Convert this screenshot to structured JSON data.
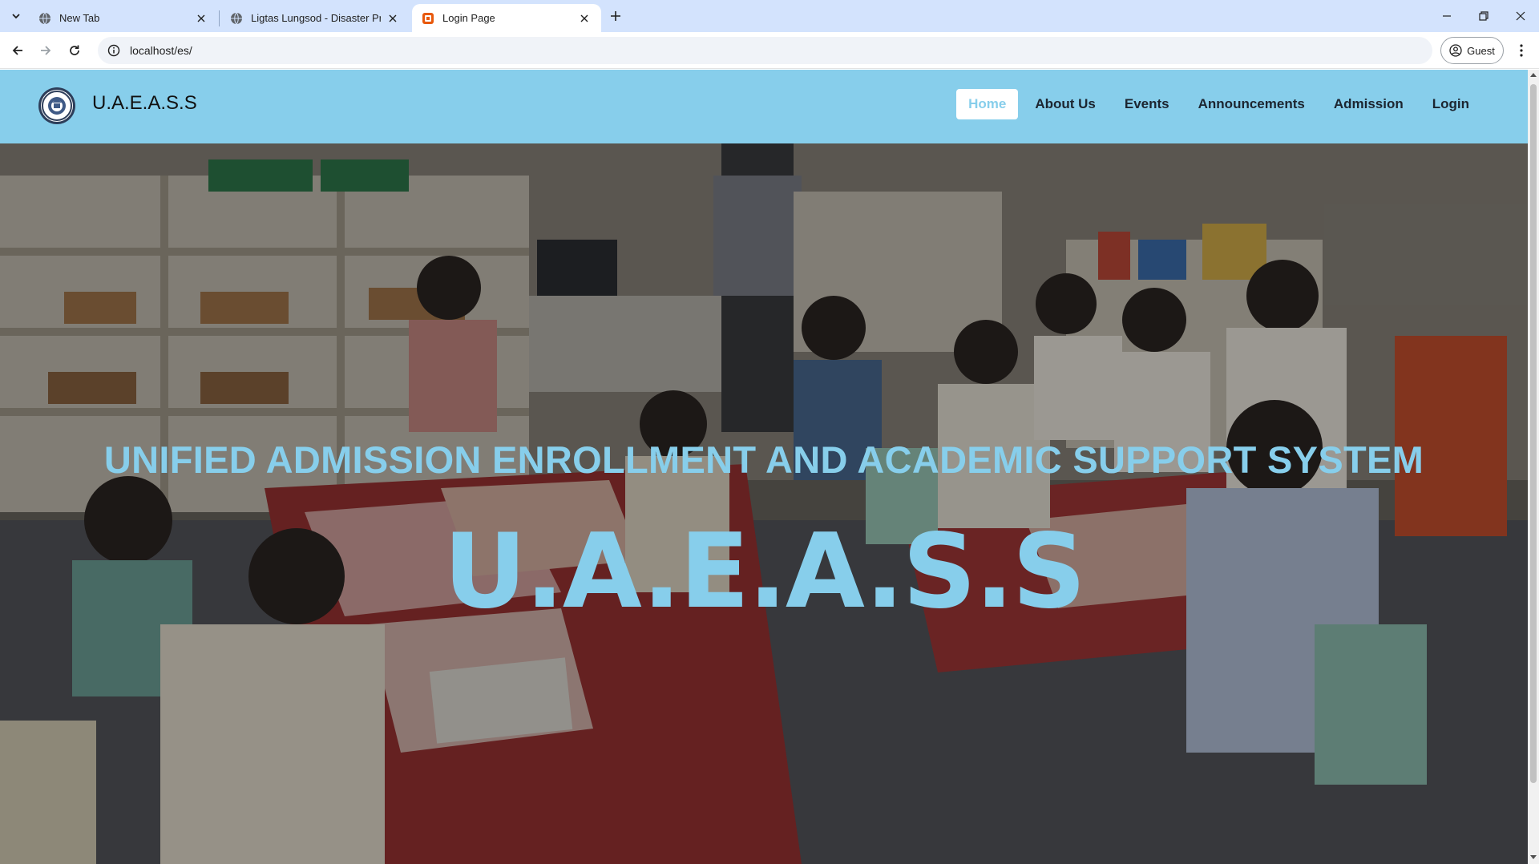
{
  "browser": {
    "tabs": [
      {
        "title": "New Tab",
        "icon": "globe-icon",
        "active": false
      },
      {
        "title": "Ligtas Lungsod - Disaster Prepa",
        "icon": "globe-icon",
        "active": false
      },
      {
        "title": "Login Page",
        "icon": "site-favicon-icon",
        "active": true
      }
    ],
    "url": "localhost/es/",
    "profile_label": "Guest"
  },
  "site": {
    "brand": "U.A.E.A.S.S",
    "nav": [
      {
        "label": "Home",
        "active": true
      },
      {
        "label": "About Us",
        "active": false
      },
      {
        "label": "Events",
        "active": false
      },
      {
        "label": "Announcements",
        "active": false
      },
      {
        "label": "Admission",
        "active": false
      },
      {
        "label": "Login",
        "active": false
      }
    ],
    "colors": {
      "header_bg": "#87ceeb",
      "accent": "#87ceeb"
    }
  },
  "hero": {
    "subtitle": "UNIFIED ADMISSION ENROLLMENT AND ACADEMIC SUPPORT SYSTEM",
    "title": "U.A.E.A.S.S"
  }
}
